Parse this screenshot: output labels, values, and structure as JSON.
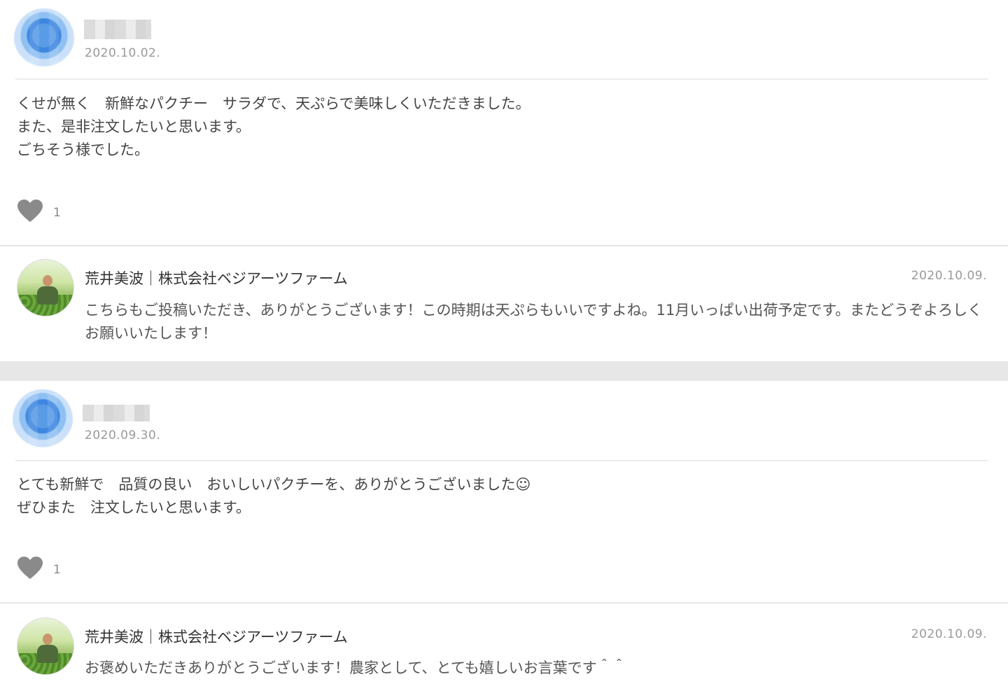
{
  "reviews": [
    {
      "date": "2020.10.02.",
      "text": "くせが無く　新鮮なパクチー　サラダで、天ぷらで美味しくいただきました。\nまた、是非注文したいと思います。\nごちそう様でした。",
      "like_count": "1",
      "reply": {
        "author": "荒井美波｜株式会社ベジアーツファーム",
        "date": "2020.10.09.",
        "text": "こちらもご投稿いただき、ありがとうございます！この時期は天ぷらもいいですよね。11月いっぱい出荷予定です。またどうぞよろしくお願いいたします！"
      }
    },
    {
      "date": "2020.09.30.",
      "text": "とても新鮮で　品質の良い　おいしいパクチーを、ありがとうございました☺\nぜひまた　注文したいと思います。",
      "like_count": "1",
      "reply": {
        "author": "荒井美波｜株式会社ベジアーツファーム",
        "date": "2020.10.09.",
        "text": "お褒めいただきありがとうございます！農家として、とても嬉しいお言葉です＾＾"
      }
    }
  ],
  "icons": {
    "like": "heart-icon",
    "reviewer_avatar": "blurred-avatar",
    "reply_avatar": "farmer-photo-avatar"
  },
  "colors": {
    "heart": "#8a8a8a",
    "separator_band": "#e7e7e7",
    "date_text": "#999999"
  }
}
